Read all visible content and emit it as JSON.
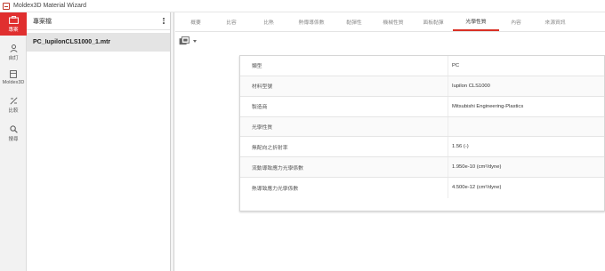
{
  "window": {
    "title": "Moldex3D Material Wizard"
  },
  "nav": {
    "items": [
      {
        "label": "專案",
        "icon": "briefcase-icon"
      },
      {
        "label": "自訂",
        "icon": "person-icon"
      },
      {
        "label": "Moldex3D",
        "icon": "database-icon"
      },
      {
        "label": "比較",
        "icon": "compare-icon"
      },
      {
        "label": "搜尋",
        "icon": "search-icon"
      }
    ]
  },
  "project": {
    "header": "專案檔",
    "file": "PC_IupilonCLS1000_1.mtr"
  },
  "tabs": [
    "概要",
    "比容",
    "比熱",
    "熱傳導係數",
    "黏彈性",
    "機械性質",
    "面板黏彈",
    "光學性質",
    "內容",
    "來源資訊"
  ],
  "active_tab": "光學性質",
  "properties": [
    {
      "label": "類型",
      "value": "PC"
    },
    {
      "label": "材料型號",
      "value": "Iupilon CLS1000"
    },
    {
      "label": "製造商",
      "value": "Mitsubishi Engineering-Plastics"
    },
    {
      "label": "光學性質",
      "value": ""
    },
    {
      "label": "無配向之折射率",
      "value": "1.56 (-)"
    },
    {
      "label": "流動導致應力光學係數",
      "value": "1.950e-10 (cm²/dyne)"
    },
    {
      "label": "熱導致應力光學係數",
      "value": "4.500e-12 (cm²/dyne)"
    }
  ],
  "colors": {
    "accent": "#d93025",
    "nav_active": "#e02f2f"
  }
}
